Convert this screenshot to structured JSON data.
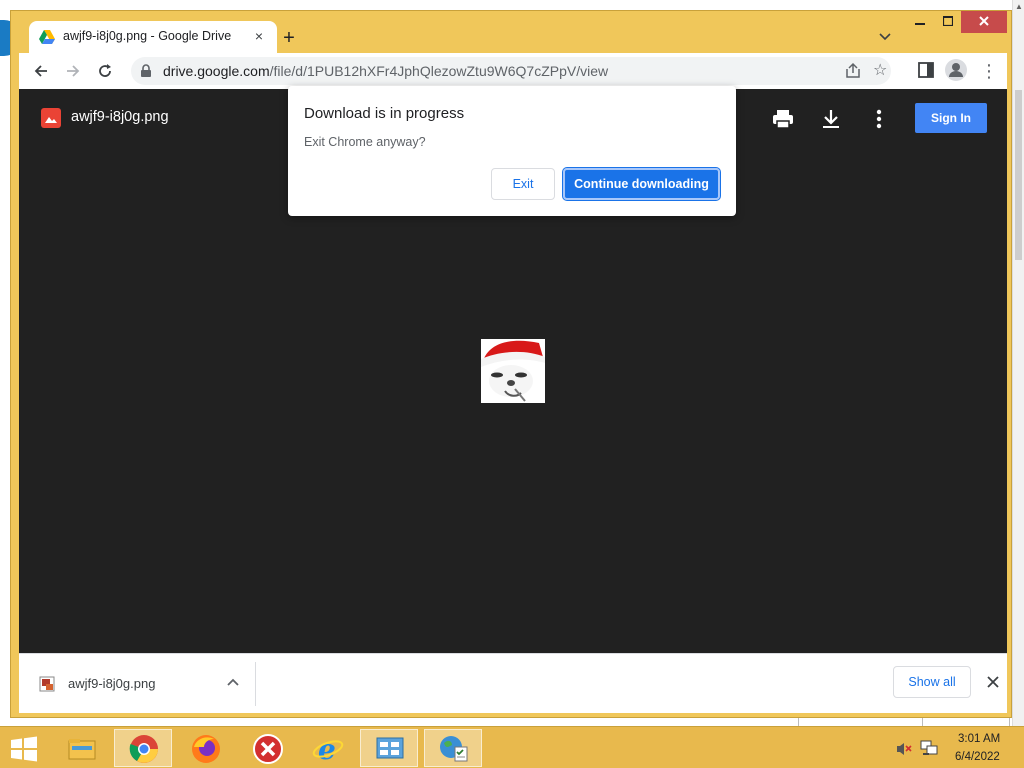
{
  "browser": {
    "tab_title": "awjf9-i8j0g.png - Google Drive",
    "tab_close_glyph": "×",
    "new_tab_glyph": "+",
    "url_host": "drive.google.com",
    "url_path": "/file/d/1PUB12hXFr4JphQlezowZtu9W6Q7cZPpV/view",
    "menu_glyph": "⋮"
  },
  "viewer": {
    "file_name": "awjf9-i8j0g.png",
    "sign_in_label": "Sign In"
  },
  "dialog": {
    "title": "Download is in progress",
    "message": "Exit Chrome anyway?",
    "exit_label": "Exit",
    "continue_label": "Continue downloading"
  },
  "download_shelf": {
    "file_name": "awjf9-i8j0g.png",
    "show_all_label": "Show all"
  },
  "taskbar": {
    "time": "3:01 AM",
    "date": "6/4/2022",
    "apps": [
      "file-explorer",
      "chrome",
      "firefox",
      "close-app",
      "internet-explorer",
      "control-panel",
      "windows-update"
    ]
  },
  "colors": {
    "window_frame": "#f0c75a",
    "taskbar": "#e8b94d",
    "viewer_bg": "#212121",
    "accent_blue": "#1a73e8",
    "sign_in_blue": "#4285f4"
  }
}
